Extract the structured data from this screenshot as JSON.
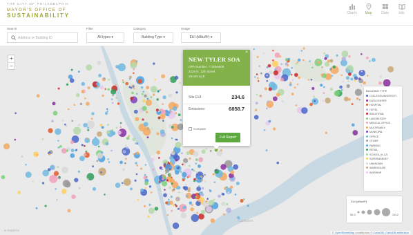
{
  "header": {
    "logo_line1": "THE CITY OF PHILADELPHIA",
    "logo_line2": "MAYOR'S OFFICE OF",
    "logo_line3": "SUSTAINABILITY",
    "nav": [
      {
        "label": "Charts",
        "icon": "bar-chart-icon",
        "active": false
      },
      {
        "label": "Map",
        "icon": "map-pin-icon",
        "active": true
      },
      {
        "label": "Data",
        "icon": "table-icon",
        "active": false
      },
      {
        "label": "Info",
        "icon": "book-icon",
        "active": false
      }
    ]
  },
  "filters": {
    "search_label": "Search",
    "search_placeholder": "Address or Building ID",
    "filter_label": "Filter",
    "filter_value": "All types ▾",
    "category_label": "Category",
    "category_value": "Building Type ▾",
    "usage_label": "Usage",
    "usage_value": "EUI (kBtu/ft²) ▾"
  },
  "map": {
    "zoom_in": "+",
    "zoom_out": "−",
    "labels": [
      "Camden"
    ],
    "background_color": "#eaeaea",
    "water_color": "#c9d9e3"
  },
  "popup": {
    "close": "×",
    "title": "NEW TYLER SOA",
    "line1": "OPA Number: 773059008",
    "line2": "2229 N. 12th street",
    "line3": "28,029 sq ft",
    "row1_label": "Site EUI:",
    "row1_value": "234.6",
    "row2_label": "Emissions:",
    "row2_value": "6858.7",
    "compare_label": "Compare",
    "button_label": "Full Report",
    "header_color": "#83b24b"
  },
  "legend": {
    "title": "BUILDING TYPE",
    "items": [
      {
        "label": "COLLEGE/UNIVERSITY",
        "color": "#4a66c8"
      },
      {
        "label": "DATA CENTER",
        "color": "#8a2ea0"
      },
      {
        "label": "HOSPITAL",
        "color": "#e05a2a"
      },
      {
        "label": "HOTEL",
        "color": "#b0b0e0"
      },
      {
        "label": "INDUSTRIAL",
        "color": "#c82828"
      },
      {
        "label": "LABORATORY",
        "color": "#7ccf7a"
      },
      {
        "label": "MEDICAL OFFICE",
        "color": "#f0a0b8"
      },
      {
        "label": "MULTIFAMILY",
        "color": "#f4a862"
      },
      {
        "label": "MUNICIPAL",
        "color": "#7a40c0"
      },
      {
        "label": "OFFICE",
        "color": "#6fb8e0"
      },
      {
        "label": "OTHER",
        "color": "#999999"
      },
      {
        "label": "PARKING",
        "color": "#4f9fe0"
      },
      {
        "label": "RETAIL",
        "color": "#2f9e5a"
      },
      {
        "label": "SCHOOL (K-12)",
        "color": "#b4d8a8"
      },
      {
        "label": "SUPERMARKET",
        "color": "#ffcf5a"
      },
      {
        "label": "UNKNOWN",
        "color": "#d8d8d8"
      },
      {
        "label": "WAREHOUSE",
        "color": "#c8a878"
      },
      {
        "label": "WORSHIP",
        "color": "#e8c8f0"
      }
    ]
  },
  "size_legend": {
    "title": "EUI (kBtu/ft²)",
    "min_label": "56.3",
    "max_label": "2412"
  },
  "attribution": {
    "prefix": "© ",
    "osm": "OpenStreetMap",
    "contrib": " contributors © ",
    "carto": "CartoDB",
    "sep": ", ",
    "cartodb_link": "CartoDB attribution"
  }
}
